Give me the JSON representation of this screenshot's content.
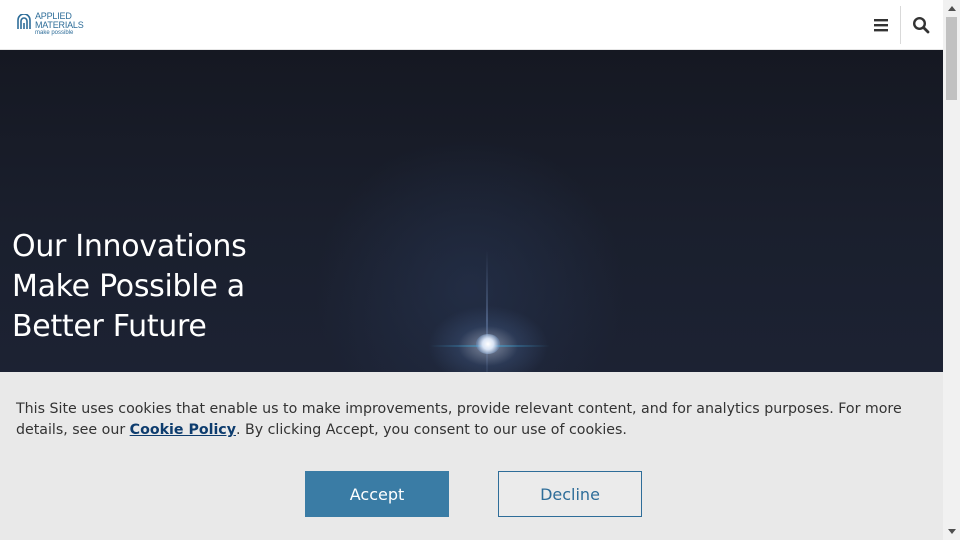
{
  "header": {
    "logo": {
      "name_line1": "APPLIED",
      "name_line2": "MATERIALS",
      "tagline": "make possible"
    },
    "menu_icon": "hamburger-menu-icon",
    "search_icon": "search-icon"
  },
  "hero": {
    "title_line1": "Our Innovations",
    "title_line2": "Make Possible a",
    "title_line3": "Better Future"
  },
  "cookie_banner": {
    "text_before": "This Site uses cookies that enable us to make improvements, provide relevant content, and for analytics purposes. For more details, see our ",
    "link_label": "Cookie Policy",
    "text_after": ". By clicking Accept, you consent to our use of cookies.",
    "accept_label": "Accept",
    "decline_label": "Decline"
  },
  "colors": {
    "brand": "#2e6d99",
    "accept_button": "#3a7ca5",
    "banner_background": "#e9e9e9",
    "hero_background": "#171b26"
  }
}
